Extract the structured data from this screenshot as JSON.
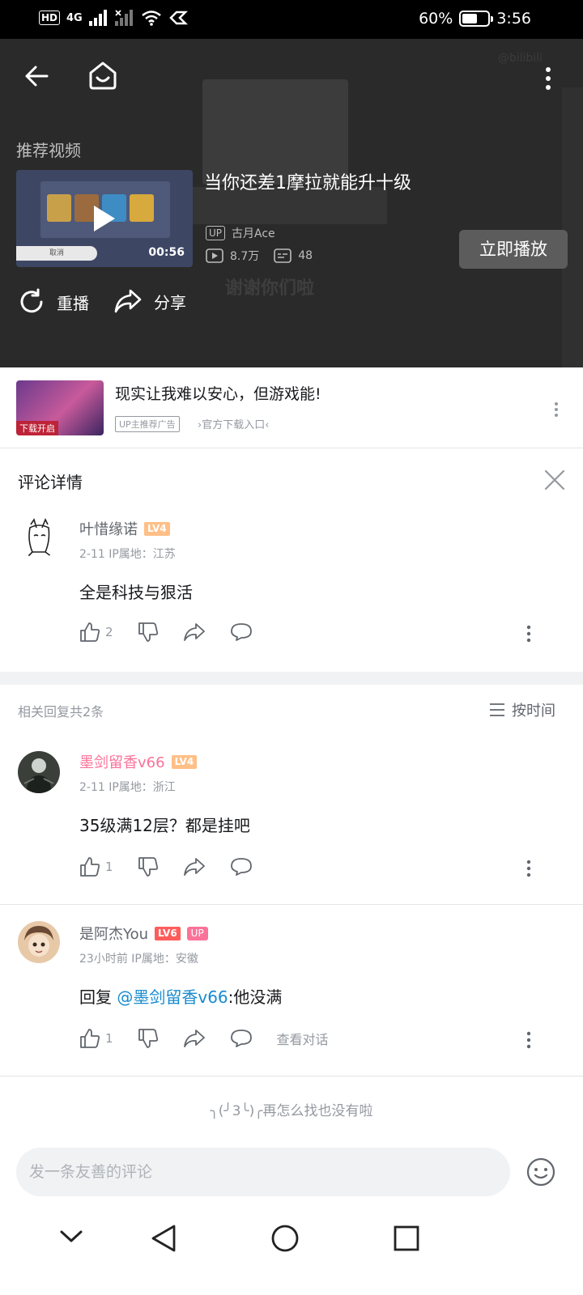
{
  "status_bar": {
    "left_badges": [
      "HD",
      "4G"
    ],
    "battery_percent": "60%",
    "battery_level": 0.6,
    "time": "3:56"
  },
  "player": {
    "background_overlay_text": "谢谢你们啦",
    "watermark": "@bilibili",
    "recommend_label": "推荐视频",
    "video": {
      "title": "当你还差1摩拉就能升十级",
      "duration": "00:56",
      "thumb_cancel": "取消",
      "up_badge": "UP",
      "uploader": "古月Ace",
      "views": "8.7万",
      "danmaku": "48"
    },
    "play_now": "立即播放",
    "replay": "重播",
    "share": "分享"
  },
  "ad": {
    "image_label": "下载开启",
    "title": "现实让我难以安心，但游戏能!",
    "tag": "UP主推荐广告",
    "link": "›官方下载入口‹"
  },
  "comment_panel": {
    "title": "评论详情"
  },
  "root_comment": {
    "username": "叶惜缘诺",
    "level": "LV4",
    "meta": "2-11  IP属地：江苏",
    "text": "全是科技与狠活",
    "likes": "2"
  },
  "replies_header": {
    "count_text": "相关回复共2条",
    "sort_label": "按时间"
  },
  "replies": [
    {
      "username": "墨剑留香v66",
      "level": "LV4",
      "meta": "2-11  IP属地：浙江",
      "text": "35级满12层？都是挂吧",
      "likes": "1"
    },
    {
      "username": "是阿杰You",
      "level": "LV6",
      "up_badge": "UP",
      "meta": "23小时前  IP属地：安徽",
      "reply_prefix": "回复 ",
      "mention": "@墨剑留香v66",
      "text": ":他没满",
      "likes": "1",
      "see_conversation": "查看对话"
    }
  ],
  "end_message": "╮(╯3╰)╭再怎么找也没有啦",
  "input": {
    "placeholder": "发一条友善的评论"
  },
  "colors": {
    "bilibili_pink": "#fb7299",
    "mention_blue": "#178bcf",
    "level4": "#ffbf86",
    "level6": "#ff5c5c"
  }
}
